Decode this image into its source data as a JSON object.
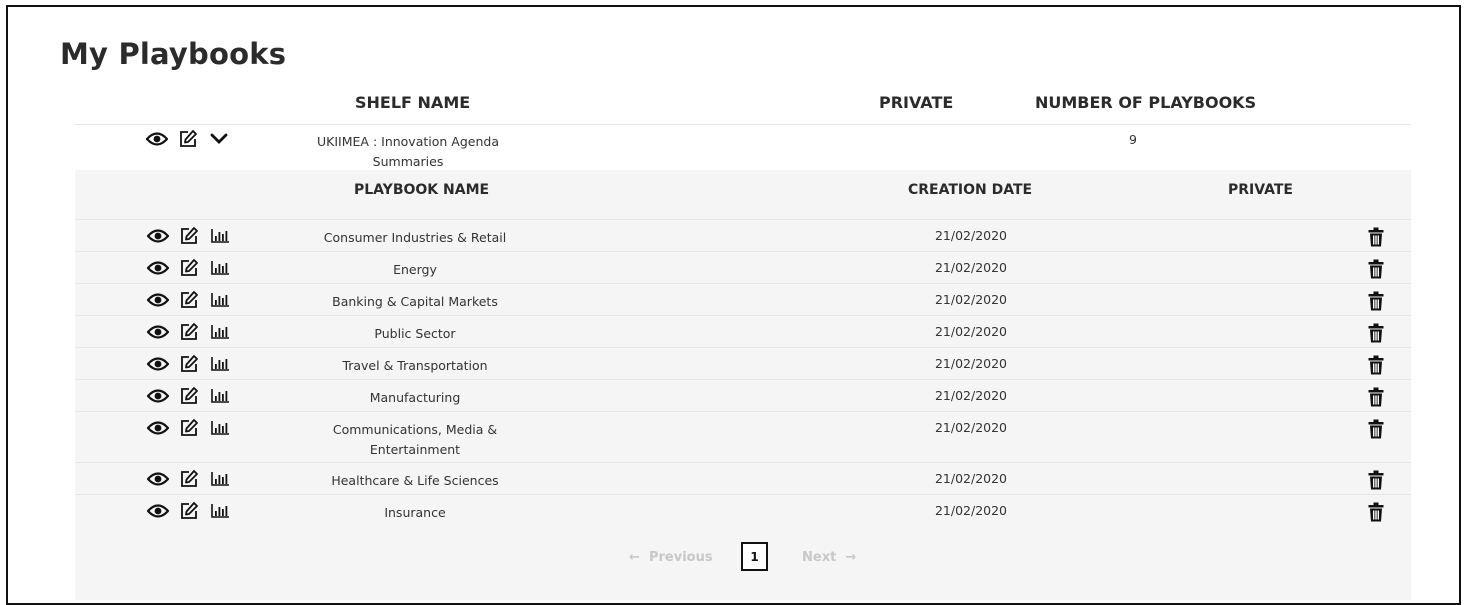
{
  "page": {
    "title": "My Playbooks"
  },
  "shelf_table": {
    "headers": {
      "shelf_name": "SHELF NAME",
      "private": "PRIVATE",
      "number_of_playbooks": "NUMBER OF PLAYBOOKS"
    },
    "shelf": {
      "name": "UKIIMEA : Innovation Agenda Summaries",
      "private": "",
      "count": "9",
      "icons": [
        "eye-icon",
        "edit-icon",
        "chevron-down-icon"
      ]
    }
  },
  "playbook_table": {
    "headers": {
      "playbook_name": "PLAYBOOK NAME",
      "creation_date": "CREATION DATE",
      "private": "PRIVATE"
    },
    "row_icons": [
      "eye-icon",
      "edit-icon",
      "bar-chart-icon",
      "trash-icon"
    ],
    "rows": [
      {
        "name": "Consumer Industries & Retail",
        "date": "21/02/2020"
      },
      {
        "name": "Energy",
        "date": "21/02/2020"
      },
      {
        "name": "Banking & Capital Markets",
        "date": "21/02/2020"
      },
      {
        "name": "Public Sector",
        "date": "21/02/2020"
      },
      {
        "name": "Travel & Transportation",
        "date": "21/02/2020"
      },
      {
        "name": "Manufacturing",
        "date": "21/02/2020"
      },
      {
        "name": "Communications, Media & Entertainment",
        "date": "21/02/2020"
      },
      {
        "name": "Healthcare & Life Sciences",
        "date": "21/02/2020"
      },
      {
        "name": "Insurance",
        "date": "21/02/2020"
      }
    ]
  },
  "pagination": {
    "previous": "Previous",
    "current": "1",
    "next": "Next",
    "prev_arrow": "←",
    "next_arrow": "→"
  },
  "colors": {
    "text": "#222222",
    "row_bg": "#f5f5f5",
    "disabled": "#c8c8c8"
  }
}
